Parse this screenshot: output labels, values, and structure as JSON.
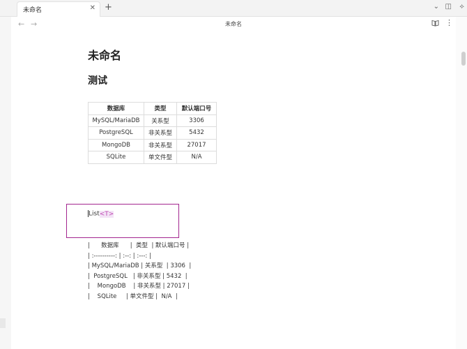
{
  "tab": {
    "title": "未命名",
    "close": "✕",
    "add": "+"
  },
  "window": {
    "chevron": "⌄",
    "layout": "◫",
    "clip": "⟡"
  },
  "nav": {
    "back": "←",
    "forward": "→",
    "title": "未命名",
    "book_icon": "📖",
    "more": "⋮"
  },
  "document": {
    "title": "未命名",
    "heading": "测试",
    "table": {
      "headers": [
        "数据库",
        "类型",
        "默认端口号"
      ],
      "rows": [
        [
          "MySQL/MariaDB",
          "关系型",
          "3306"
        ],
        [
          "PostgreSQL",
          "非关系型",
          "5432"
        ],
        [
          "MongoDB",
          "非关系型",
          "27017"
        ],
        [
          "SQLite",
          "单文件型",
          "N/A"
        ]
      ]
    },
    "code": {
      "keyword": "List",
      "type_param": "<T>"
    },
    "raw_lines": [
      "|      数据库      |  类型  | 默认端口号 |",
      "| :----------: | :--: | :---: |",
      "| MySQL/MariaDB | 关系型  | 3306  |",
      "|  PostgreSQL   | 非关系型 | 5432  |",
      "|    MongoDB    | 非关系型 | 27017 |",
      "|    SQLite     | 单文件型 |  N/A  |"
    ]
  }
}
